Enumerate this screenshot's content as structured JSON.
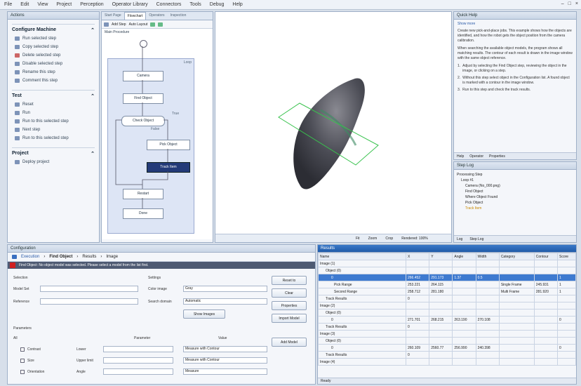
{
  "menu": [
    "File",
    "Edit",
    "View",
    "Project",
    "Perception",
    "Operator Library",
    "Connectors",
    "Tools",
    "Debug",
    "Help"
  ],
  "window": {
    "min": "–",
    "max": "□",
    "close": "×"
  },
  "left_panel": {
    "title": "Actions",
    "sections": [
      {
        "title": "Configure Machine",
        "items": [
          "Run selected step",
          "Copy selected step",
          "Delete selected step",
          "Disable selected step",
          "Rename this step",
          "Comment this step"
        ]
      },
      {
        "title": "Test",
        "items": [
          "Reset",
          "Run",
          "Run to this selected step",
          "Next step",
          "Run to this selected step"
        ]
      },
      {
        "title": "Project",
        "items": [
          "Deploy project"
        ]
      }
    ]
  },
  "flow_panel": {
    "tabs": [
      "Start Page",
      "Flowchart",
      "Operators",
      "Inspection"
    ],
    "toolbar": {
      "label1": "Add Step",
      "label2": "Auto Layout"
    },
    "group_label": "Main Procedure",
    "group_corner": "Loop",
    "nodes": [
      "Camera",
      "Find Object",
      "Check Object",
      "Pick Object",
      "Track Item",
      "Restart",
      "Done"
    ],
    "edge_labels": [
      "True",
      "False"
    ]
  },
  "view_panel": {
    "footer": {
      "a": "Fit",
      "b": "Zoom",
      "c": "Crop",
      "d": "Rendered: 100%"
    }
  },
  "help_panel": {
    "title": "Quick Help",
    "link": "Show more",
    "paragraphs": [
      "Create new pick-and-place jobs. This example shows how the objects are identified, and how the robot gets the object position from the camera calibration.",
      "When searching the available object models, the program shows all matching results. The contour of each result is drawn in the image window with the same object reference."
    ],
    "steps": [
      "Adjust by selecting the Find Object step, reviewing the object in the image, or clicking on a step.",
      "Without this step select object in the Configuration list. A found object is marked with a contour in the image window.",
      "Run to this step and check the track results."
    ],
    "tabs": [
      "Help",
      "Operator",
      "Properties"
    ]
  },
  "tree_panel": {
    "title": "Step Log",
    "items": [
      "Processing Step",
      "Loop #1",
      "Camera (No_000.png)",
      "Find Object",
      "Where Object Found",
      "Pick Object",
      "Track Item"
    ],
    "tabs": [
      "Log",
      "Step Log"
    ]
  },
  "config_panel": {
    "title": "Configuration",
    "breadcrumb": [
      "Execution",
      "Find Object",
      "Results",
      "Image"
    ],
    "error": "Find Object: No object model was selected. Please select a model from the list first.",
    "group_left": "Selection",
    "fields_left": [
      {
        "label": "Model Set",
        "value": ""
      },
      {
        "label": "Reference",
        "value": ""
      }
    ],
    "group_right": "Settings",
    "fields_right": [
      {
        "label": "Color image",
        "value": "Gray"
      },
      {
        "label": "Search domain",
        "value": "Automatic"
      }
    ],
    "show_btn": "Show Images",
    "buttons": [
      "Reset to",
      "Clear",
      "Properties",
      "Import Model",
      "Add Model"
    ],
    "group_params": "Parameters",
    "param_header": [
      "All",
      "Parameter",
      "Value"
    ],
    "params": [
      {
        "name": "Contrast",
        "sub": "Lower",
        "value": "",
        "mode": "Measure with Contour"
      },
      {
        "name": "Size",
        "sub": "Upper limit",
        "value": "",
        "mode": "Measure with Contour"
      },
      {
        "name": "Orientation",
        "sub": "Angle",
        "value": "",
        "mode": "Measure"
      }
    ]
  },
  "results_panel": {
    "title": "Results",
    "columns": [
      "Name",
      "X",
      "Y",
      "Angle",
      "Width",
      "Category",
      "Contour",
      "Score"
    ],
    "rows": [
      [
        "Image (1)",
        "",
        "",
        "",
        "",
        "",
        "",
        ""
      ],
      [
        "Object (0)",
        "",
        "",
        "",
        "",
        "",
        "",
        ""
      ],
      [
        "0",
        "266.452",
        "291.173",
        "1.37",
        "0.5",
        "",
        "",
        "1"
      ],
      [
        "Pick Range",
        "253.221",
        "264.115",
        "",
        "",
        "Single Frame",
        "245.931",
        "1"
      ],
      [
        "Second Range",
        "258.712",
        "281.180",
        "",
        "",
        "Multi Frame",
        "281.920",
        "1"
      ],
      [
        "Track Results",
        "0",
        "",
        "",
        "",
        "",
        "",
        ""
      ],
      [
        "Image (2)",
        "",
        "",
        "",
        "",
        "",
        "",
        ""
      ],
      [
        "Object (0)",
        "",
        "",
        "",
        "",
        "",
        "",
        ""
      ],
      [
        "0",
        "271.701",
        "268.215",
        "263.190",
        "270.108",
        "",
        "",
        "0"
      ],
      [
        "Track Results",
        "0",
        "",
        "",
        "",
        "",
        "",
        ""
      ],
      [
        "Image (3)",
        "",
        "",
        "",
        "",
        "",
        "",
        ""
      ],
      [
        "Object (0)",
        "",
        "",
        "",
        "",
        "",
        "",
        ""
      ],
      [
        "0",
        "260.109",
        "2560.77",
        "256.990",
        "240.398",
        "",
        "",
        "0"
      ],
      [
        "Track Results",
        "0",
        "",
        "",
        "",
        "",
        "",
        ""
      ],
      [
        "Image (4)",
        "",
        "",
        "",
        "",
        "",
        "",
        ""
      ]
    ],
    "status": "Ready"
  }
}
